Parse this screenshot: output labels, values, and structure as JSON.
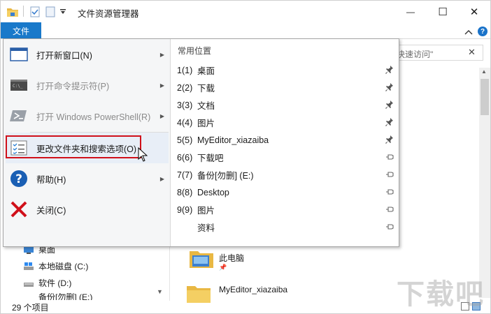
{
  "window": {
    "title": "文件资源管理器",
    "minimize_glyph": "—",
    "maximize_glyph": "☐",
    "close_glyph": "✕"
  },
  "ribbon": {
    "file_tab_label": "文件"
  },
  "search": {
    "value": "快速访问\""
  },
  "file_menu": {
    "left_items": [
      {
        "label": "打开新窗口(N)",
        "icon": "new-window-icon",
        "has_submenu": true,
        "enabled": true
      },
      {
        "label": "打开命令提示符(P)",
        "icon": "command-prompt-icon",
        "has_submenu": true,
        "enabled": false
      },
      {
        "label": "打开 Windows PowerShell(R)",
        "icon": "powershell-icon",
        "has_submenu": true,
        "enabled": false
      },
      {
        "label": "更改文件夹和搜索选项(O)",
        "icon": "folder-options-icon",
        "has_submenu": false,
        "enabled": true,
        "highlighted": true
      },
      {
        "label": "帮助(H)",
        "icon": "help-icon",
        "has_submenu": true,
        "enabled": true
      },
      {
        "label": "关闭(C)",
        "icon": "close-icon",
        "has_submenu": false,
        "enabled": true
      }
    ],
    "frequent_title": "常用位置",
    "frequent_places": [
      {
        "num": "1(1)",
        "name": "桌面",
        "pinned": true
      },
      {
        "num": "2(2)",
        "name": "下载",
        "pinned": true
      },
      {
        "num": "3(3)",
        "name": "文档",
        "pinned": true
      },
      {
        "num": "4(4)",
        "name": "图片",
        "pinned": true
      },
      {
        "num": "5(5)",
        "name": "MyEditor_xiazaiba",
        "pinned": true
      },
      {
        "num": "6(6)",
        "name": "下载吧",
        "pinned": false
      },
      {
        "num": "7(7)",
        "name": "备份[勿删] (E:)",
        "pinned": false
      },
      {
        "num": "8(8)",
        "name": "Desktop",
        "pinned": false
      },
      {
        "num": "9(9)",
        "name": "图片",
        "pinned": false
      },
      {
        "num": "",
        "name": "资料",
        "pinned": false
      }
    ]
  },
  "nav_pane": {
    "items": [
      {
        "label": "桌面",
        "icon": "desktop-icon"
      },
      {
        "label": "本地磁盘 (C:)",
        "icon": "drive-icon"
      },
      {
        "label": "软件 (D:)",
        "icon": "drive-icon"
      },
      {
        "label": "备份[勿删] (E:)",
        "icon": "drive-icon"
      }
    ]
  },
  "content": {
    "items": [
      {
        "label": "此电脑"
      },
      {
        "label": "MyEditor_xiazaiba"
      }
    ]
  },
  "status": {
    "item_count": "29 个项目"
  },
  "colors": {
    "accent": "#1979ca",
    "highlight_border": "#d0101a",
    "menu_bg": "#f5f6f7"
  }
}
